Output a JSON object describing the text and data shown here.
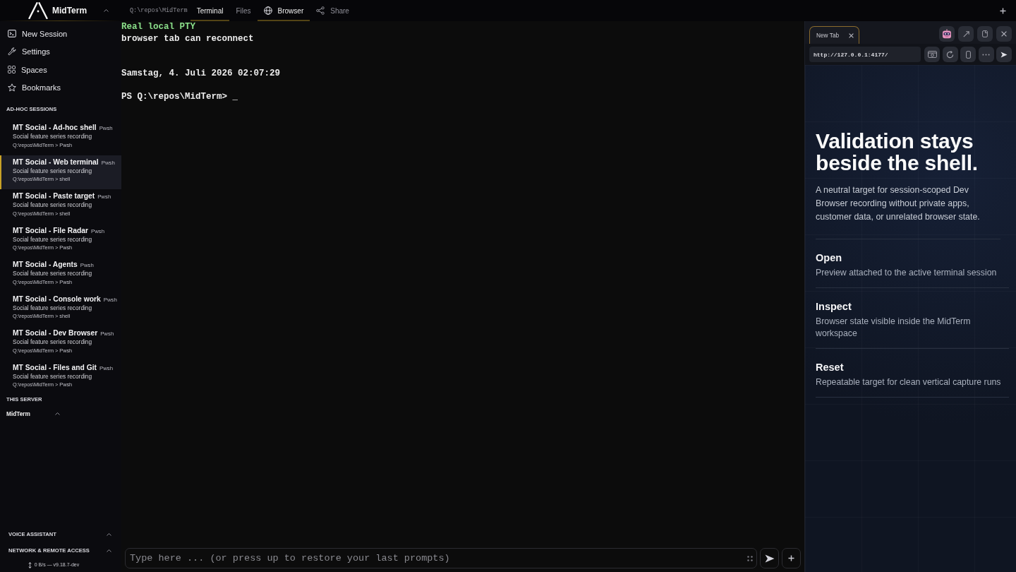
{
  "app": {
    "name": "MidTerm"
  },
  "top_bar": {
    "path": "Q:\\repos\\MidTerm",
    "tabs": [
      {
        "label": "Terminal",
        "kind": "view",
        "selected": true
      },
      {
        "label": "Files",
        "kind": "view",
        "selected": false
      },
      {
        "label": "Browser",
        "kind": "panel",
        "selected": true
      },
      {
        "label": "Share",
        "kind": "action",
        "selected": false
      }
    ]
  },
  "sidebar": {
    "menu": [
      "New Session",
      "Settings",
      "Spaces",
      "Bookmarks"
    ],
    "sessions_heading": "AD-HOC SESSIONS",
    "sessions": [
      {
        "title": "MT Social - Ad-hoc shell",
        "shell": "Pwsh",
        "description": "Social feature series recording",
        "path": "Q:\\repos\\MidTerm > Pwsh",
        "selected": false
      },
      {
        "title": "MT Social - Web terminal",
        "shell": "Pwsh",
        "description": "Social feature series recording",
        "path": "Q:\\repos\\MidTerm > shell",
        "selected": true
      },
      {
        "title": "MT Social - Paste target",
        "shell": "Pwsh",
        "description": "Social feature series recording",
        "path": "Q:\\repos\\MidTerm > shell",
        "selected": false
      },
      {
        "title": "MT Social - File Radar",
        "shell": "Pwsh",
        "description": "Social feature series recording",
        "path": "Q:\\repos\\MidTerm > Pwsh",
        "selected": false
      },
      {
        "title": "MT Social - Agents",
        "shell": "Pwsh",
        "description": "Social feature series recording",
        "path": "Q:\\repos\\MidTerm > Pwsh",
        "selected": false
      },
      {
        "title": "MT Social - Console work",
        "shell": "Pwsh",
        "description": "Social feature series recording",
        "path": "Q:\\repos\\MidTerm > shell",
        "selected": false
      },
      {
        "title": "MT Social - Dev Browser",
        "shell": "Pwsh",
        "description": "Social feature series recording",
        "path": "Q:\\repos\\MidTerm > Pwsh",
        "selected": false
      },
      {
        "title": "MT Social - Files and Git",
        "shell": "Pwsh",
        "description": "Social feature series recording",
        "path": "Q:\\repos\\MidTerm > Pwsh",
        "selected": false
      }
    ],
    "server_heading": "THIS SERVER",
    "server": "MidTerm",
    "panels": [
      "VOICE ASSISTANT",
      "NETWORK & REMOTE ACCESS"
    ],
    "status": "0 B/s — v9.18.7-dev"
  },
  "terminal": {
    "lines": [
      {
        "text": "Real local PTY",
        "kind": "status"
      },
      {
        "text": "browser tab can reconnect",
        "kind": "output"
      },
      {
        "text": "Samstag, 4. Juli 2026 02:07:29",
        "kind": "timestamp"
      },
      {
        "text": "PS Q:\\repos\\MidTerm> _",
        "kind": "prompt"
      }
    ]
  },
  "prompt": {
    "placeholder": "Type here ... (or press up to restore your last prompts)"
  },
  "browser": {
    "tabs": [
      {
        "label": "New Tab",
        "selected": true
      }
    ],
    "url": "http://127.0.0.1:4177/",
    "page": {
      "heading": "Validation stays beside the shell.",
      "intro": "A neutral target for session-scoped Dev Browser recording without private apps, customer data, or unrelated browser state.",
      "features": [
        {
          "title": "Open",
          "description": "Preview attached to the active terminal session"
        },
        {
          "title": "Inspect",
          "description": "Browser state visible inside the MidTerm workspace"
        },
        {
          "title": "Reset",
          "description": "Repeatable target for clean vertical capture runs"
        }
      ]
    }
  }
}
